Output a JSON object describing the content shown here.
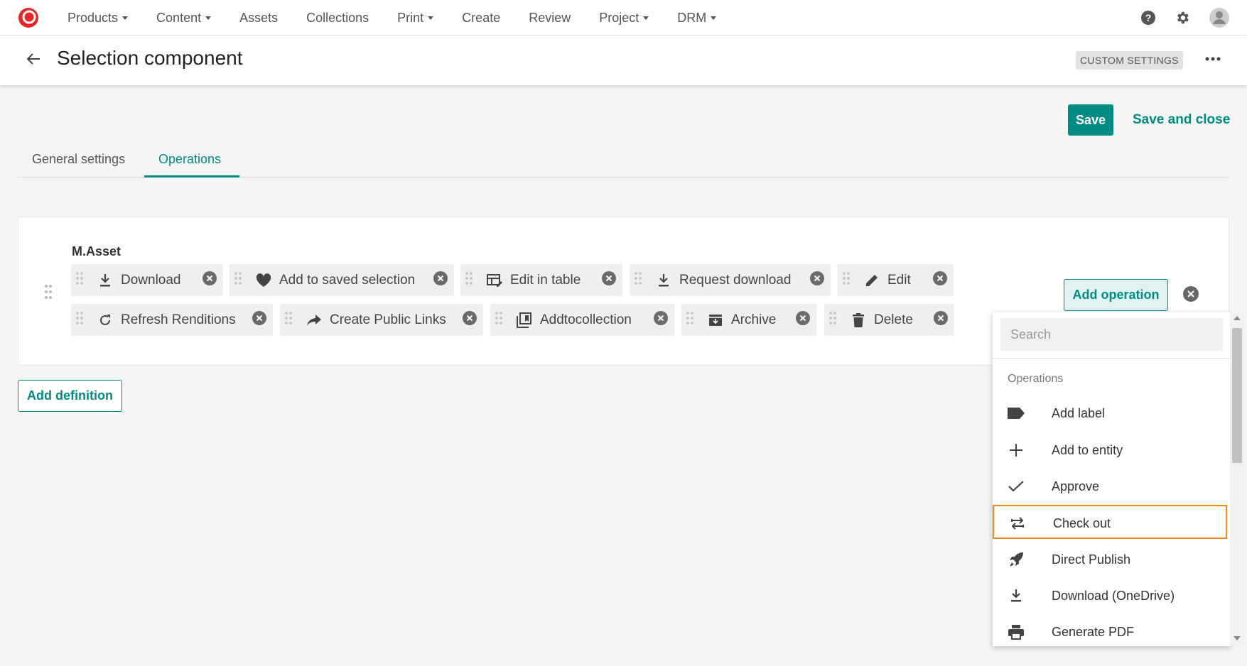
{
  "colors": {
    "accent": "#008b84",
    "logo": "#e8262a",
    "selected_outline": "#f08a24"
  },
  "nav": {
    "items": [
      {
        "label": "Products",
        "dropdown": true
      },
      {
        "label": "Content",
        "dropdown": true
      },
      {
        "label": "Assets",
        "dropdown": false
      },
      {
        "label": "Collections",
        "dropdown": false
      },
      {
        "label": "Print",
        "dropdown": true
      },
      {
        "label": "Create",
        "dropdown": false
      },
      {
        "label": "Review",
        "dropdown": false
      },
      {
        "label": "Project",
        "dropdown": true
      },
      {
        "label": "DRM",
        "dropdown": true
      }
    ],
    "icons": [
      "help-icon",
      "gear-icon",
      "user-avatar-icon"
    ]
  },
  "header": {
    "title": "Selection component",
    "badge": "CUSTOM SETTINGS"
  },
  "actions": {
    "save": "Save",
    "save_close": "Save and close"
  },
  "tabs": [
    {
      "label": "General settings",
      "active": false
    },
    {
      "label": "Operations",
      "active": true
    }
  ],
  "definition": {
    "label": "M.Asset",
    "chips": [
      {
        "label": "Download",
        "icon": "download-icon"
      },
      {
        "label": "Add to saved selection",
        "icon": "heart-icon"
      },
      {
        "label": "Edit in table",
        "icon": "table-edit-icon"
      },
      {
        "label": "Request download",
        "icon": "download-icon"
      },
      {
        "label": "Edit",
        "icon": "pencil-icon"
      },
      {
        "label": "Refresh Renditions",
        "icon": "refresh-icon"
      },
      {
        "label": "Create Public Links",
        "icon": "share-icon"
      },
      {
        "label": "Addtocollection",
        "icon": "collection-add-icon"
      },
      {
        "label": "Archive",
        "icon": "archive-icon"
      },
      {
        "label": "Delete",
        "icon": "trash-icon"
      }
    ],
    "add_operation": "Add operation"
  },
  "add_definition": "Add definition",
  "dropdown": {
    "search_placeholder": "Search",
    "heading": "Operations",
    "items": [
      {
        "label": "Add label",
        "icon": "tag-icon",
        "selected": false
      },
      {
        "label": "Add to entity",
        "icon": "plus-icon",
        "selected": false
      },
      {
        "label": "Approve",
        "icon": "check-icon",
        "selected": false
      },
      {
        "label": "Check out",
        "icon": "swap-icon",
        "selected": true
      },
      {
        "label": "Direct Publish",
        "icon": "rocket-icon",
        "selected": false
      },
      {
        "label": "Download (OneDrive)",
        "icon": "download-icon",
        "selected": false
      },
      {
        "label": "Generate PDF",
        "icon": "printer-icon",
        "selected": false
      }
    ]
  }
}
